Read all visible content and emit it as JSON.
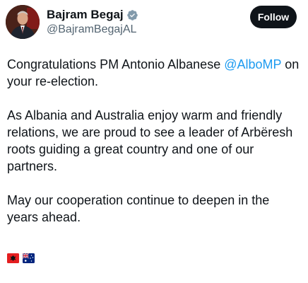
{
  "author": {
    "display_name": "Bajram Begaj",
    "handle": "@BajramBegajAL",
    "verified_icon": "verified-badge-icon"
  },
  "follow_button": {
    "label": "Follow"
  },
  "tweet": {
    "paragraph1_prefix": "Congratulations PM Antonio Albanese ",
    "mention": "@AlboMP",
    "paragraph1_suffix": " on your re-election.",
    "paragraph2": "As Albania and Australia enjoy warm and friendly relations, we are proud to see a leader of Arbëresh roots guiding a great country and one of our partners.",
    "paragraph3": "May our cooperation continue to deepen in the years ahead.",
    "flags": [
      "albania-flag-icon",
      "australia-flag-icon"
    ]
  },
  "colors": {
    "text": "#0f1419",
    "secondary_text": "#536471",
    "link": "#1d9bf0",
    "follow_bg": "#0f1419",
    "verified_badge": "#829aab"
  }
}
